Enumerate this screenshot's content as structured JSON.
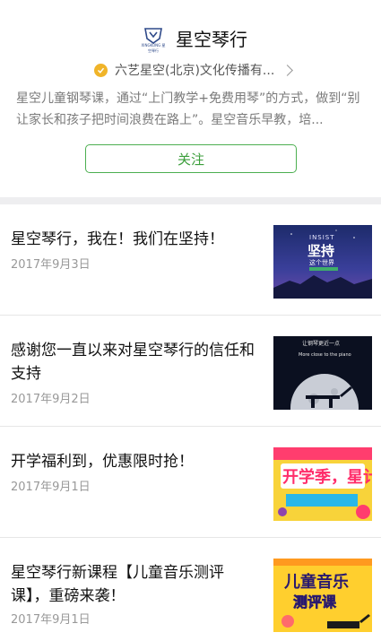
{
  "header": {
    "logo_text": "XINGKONG 星空琴行",
    "brand_name": "星空琴行",
    "verified_org": "六艺星空(北京)文化传播有...",
    "intro": "星空儿童钢琴课，通过“上门教学+免费用琴”的方式，做到“别让家长和孩子把时间浪费在路上”。星空音乐早教，培...",
    "follow_label": "关注"
  },
  "articles": [
    {
      "title": "星空琴行，我在！我们在坚持！",
      "date": "2017年9月3日",
      "thumb": {
        "big": "坚持",
        "top": "INSIST",
        "sub": "这个世界"
      }
    },
    {
      "title": "感谢您一直以来对星空琴行的信任和支持",
      "date": "2017年9月2日",
      "thumb": {
        "line1": "让钢琴更近一点",
        "line2": "More close to the piano"
      }
    },
    {
      "title": "开学福利到，优惠限时抢！",
      "date": "2017年9月1日",
      "thumb": {
        "big": "开学季，星计"
      }
    },
    {
      "title": "星空琴行新课程【儿童音乐测评课】，重磅来袭！",
      "date": "2017年9月1日",
      "thumb": {
        "line1": "儿童音乐",
        "line2": "测评课"
      }
    }
  ],
  "colors": {
    "accent_green": "#4caf50",
    "verify_gold": "#f0b429",
    "divider": "#eeeef0"
  }
}
